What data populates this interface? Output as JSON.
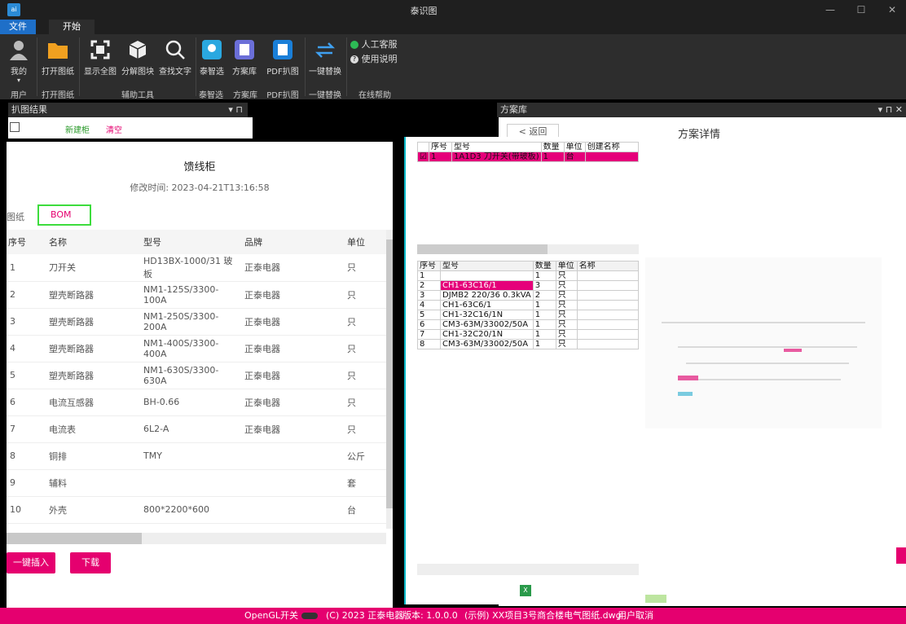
{
  "window": {
    "title": "泰识图",
    "icon_label": "ai",
    "minimize": "—",
    "maximize": "☐",
    "close": "✕"
  },
  "menu_tabs": [
    "文件",
    "开始"
  ],
  "ribbon": {
    "buttons": {
      "user": "我的",
      "open": "打开图纸",
      "show_all": "显示全图",
      "explode": "分解图块",
      "find_text": "查找文字",
      "taizhixuan": "泰智选",
      "scheme_lib": "方案库",
      "pdf_extract": "PDF扒图",
      "one_key_replace": "一键替换",
      "customer_service": "人工客服",
      "help": "使用说明"
    },
    "groups": {
      "user": "用户",
      "open": "打开图纸",
      "tools": "辅助工具",
      "taizhixuan": "泰智选",
      "scheme_lib": "方案库",
      "pdf": "PDF扒图",
      "replace": "一键替换",
      "online_help": "在线帮助"
    }
  },
  "left_panel": {
    "title": "扒图结果",
    "controls": "▾ ⊓",
    "new_cabinet": "新建柜",
    "clear": "清空"
  },
  "right_panel": {
    "title": "方案库",
    "controls": "▾ ⊓ ✕",
    "back": "< 返回",
    "detail": "方案详情"
  },
  "card": {
    "name": "馈线柜",
    "modified": "修改时间: 2023-04-21T13:16:58",
    "tab_drawings": "图纸",
    "tab_bom": "BOM",
    "columns": [
      "序号",
      "名称",
      "型号",
      "品牌",
      "单位"
    ],
    "rows": [
      [
        "1",
        "刀开关",
        "HD13BX-1000/31 玻板",
        "正泰电器",
        "只"
      ],
      [
        "2",
        "塑壳断路器",
        "NM1-125S/3300-100A",
        "正泰电器",
        "只"
      ],
      [
        "3",
        "塑壳断路器",
        "NM1-250S/3300-200A",
        "正泰电器",
        "只"
      ],
      [
        "4",
        "塑壳断路器",
        "NM1-400S/3300-400A",
        "正泰电器",
        "只"
      ],
      [
        "5",
        "塑壳断路器",
        "NM1-630S/3300-630A",
        "正泰电器",
        "只"
      ],
      [
        "6",
        "电流互感器",
        "BH-0.66",
        "正泰电器",
        "只"
      ],
      [
        "7",
        "电流表",
        "6L2-A",
        "正泰电器",
        "只"
      ],
      [
        "8",
        "铜排",
        "TMY",
        "",
        "公斤"
      ],
      [
        "9",
        "辅料",
        "",
        "",
        "套"
      ],
      [
        "10",
        "外壳",
        "800*2200*600",
        "",
        "台"
      ]
    ],
    "insert_btn": "一键插入",
    "download_btn": "下载"
  },
  "top_table": {
    "headers": [
      "序号",
      "型号",
      "数量",
      "单位",
      "创建名称"
    ],
    "row": [
      "1",
      "1A1D3 刀开关(带玻板)",
      "1",
      "台",
      ""
    ]
  },
  "mid_table": {
    "headers": [
      "序号",
      "型号",
      "数量",
      "单位",
      "名称"
    ],
    "rows": [
      [
        "1",
        "",
        "1",
        "只",
        ""
      ],
      [
        "2",
        "CH1-63C16/1",
        "3",
        "只",
        ""
      ],
      [
        "3",
        "DJMB2 220/36 0.3kVA",
        "2",
        "只",
        ""
      ],
      [
        "4",
        "CH1-63C6/1",
        "1",
        "只",
        ""
      ],
      [
        "5",
        "CH1-32C16/1N",
        "1",
        "只",
        ""
      ],
      [
        "6",
        "CM3-63M/33002/50A",
        "1",
        "只",
        ""
      ],
      [
        "7",
        "CH1-32C20/1N",
        "1",
        "只",
        ""
      ],
      [
        "8",
        "CM3-63M/33002/50A",
        "1",
        "只",
        ""
      ]
    ]
  },
  "status": {
    "opengl": "OpenGL开关",
    "copyright": "(C) 2023 正泰电器",
    "version": "版本: 1.0.0.0",
    "file": "(示例) XX项目3号商合楼电气图纸.dwg",
    "user_cancel": "用户取消"
  },
  "colors": {
    "accent": "#e5006f",
    "highlight": "#e5007a",
    "bom_tab_border": "#3ddc3d",
    "title_bar": "#1f1f1f",
    "ribbon": "#2d2d2d",
    "menu_active": "#1e6fc8"
  }
}
